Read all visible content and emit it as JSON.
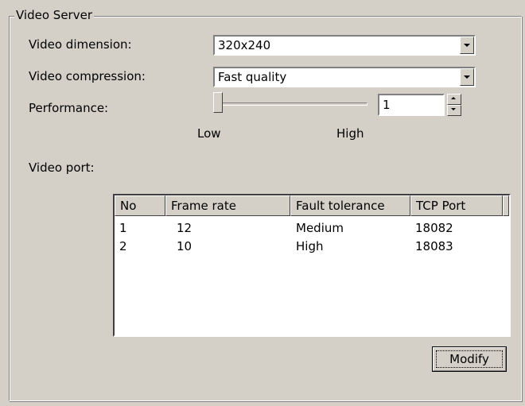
{
  "group": {
    "title": "Video Server"
  },
  "fields": {
    "dimension_label": "Video dimension:",
    "dimension_value": "320x240",
    "compression_label": "Video compression:",
    "compression_value": "Fast quality",
    "performance_label": "Performance:",
    "performance_value": "1",
    "performance_level": 0,
    "slider_low": "Low",
    "slider_high": "High",
    "port_label": "Video port:"
  },
  "table": {
    "columns": [
      "No",
      "Frame rate",
      "Fault tolerance",
      "TCP Port"
    ],
    "rows": [
      [
        "1",
        "12",
        "Medium",
        "18082"
      ],
      [
        "2",
        "10",
        "High",
        "18083"
      ]
    ]
  },
  "buttons": {
    "modify": "Modify"
  },
  "icons": {
    "dropdown": "chevron-down-icon",
    "spin_up": "arrow-up-icon",
    "spin_down": "arrow-down-icon"
  }
}
